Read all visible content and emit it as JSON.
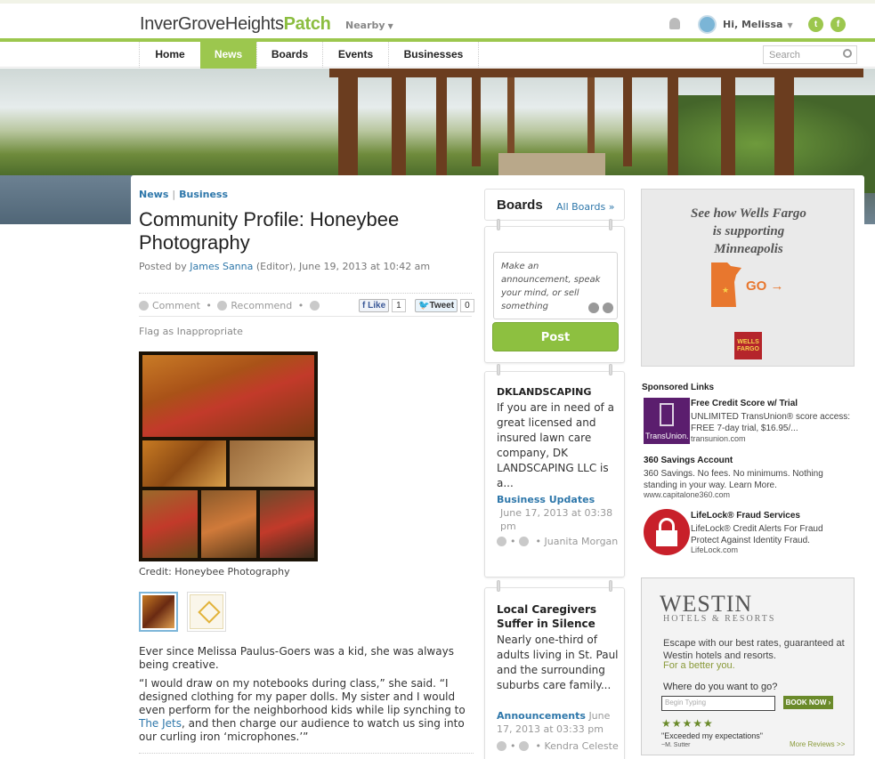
{
  "header": {
    "logo_town": "InverGroveHeights",
    "logo_brand": "Patch",
    "nearby_label": "Nearby",
    "greeting": "Hi, Melissa",
    "twitter_glyph": "t",
    "facebook_glyph": "f",
    "icons": [
      "bell-icon",
      "avatar-icon",
      "twitter-icon",
      "facebook-icon"
    ]
  },
  "nav": {
    "items": [
      "Home",
      "News",
      "Boards",
      "Events",
      "Businesses"
    ],
    "active": "News",
    "search_placeholder": "Search"
  },
  "article": {
    "breadcrumb": [
      "News",
      "Business"
    ],
    "title": "Community Profile: Honeybee Photography",
    "byline_prefix": "Posted by",
    "author": "James Sanna",
    "byline_suffix": "(Editor), June 19, 2013 at 10:42 am",
    "actions": {
      "comment": "Comment",
      "recommend": "Recommend",
      "like_label": "Like",
      "like_count": "1",
      "tweet_label": "Tweet",
      "tweet_count": "0"
    },
    "flag": "Flag as Inappropriate",
    "photo_credit": "Credit: Honeybee Photography",
    "para1": "Ever since Melissa Paulus-Goers was a kid, she was always being creative.",
    "para2_before": "“I would draw on my notebooks during class,” she said. “I designed clothing for my paper dolls. My sister and I would even perform for the neighborhood kids while lip synching to ",
    "para2_link": "The Jets",
    "para2_after": ", and then charge our audience to watch us sing into our curling iron ‘microphones.’”"
  },
  "boards": {
    "heading": "Boards",
    "all_link": "All Boards »",
    "compose_placeholder": "Make an announcement, speak your mind, or sell something",
    "post_button": "Post",
    "posts": [
      {
        "title": "DKLANDSCAPING",
        "text": "If you are in need of a great licensed and insured lawn care company, DK LANDSCAPING LLC is a...",
        "category": "Business Updates",
        "date": "June 17, 2013 at 03:38 pm",
        "author": "• Juanita Morgan"
      },
      {
        "title": "Local Caregivers Suffer in Silence",
        "text": "Nearly one-third of adults living in St. Paul and the surrounding suburbs care family...",
        "category": "Announcements",
        "date": "June 17, 2013 at 03:33 pm",
        "author": "• Kendra Celeste"
      }
    ]
  },
  "sidebar": {
    "wellsfargo_ad": {
      "line1": "See how Wells Fargo",
      "line2": "is supporting",
      "line3": "Minneapolis",
      "cta": "GO",
      "logo_text": "WELLS FARGO",
      "state_color": "#e8772e",
      "logo_color": "#b5252b"
    },
    "sponsored_heading": "Sponsored Links",
    "sponsored": [
      {
        "title": "Free Credit Score w/ Trial",
        "text": "UNLIMITED TransUnion® score access: FREE 7-day trial, $16.95/...",
        "url": "transunion.com",
        "logo_text": "TransUnion."
      },
      {
        "title": "360 Savings Account",
        "text": "360 Savings. No fees. No minimums. Nothing standing in your way. Learn More.",
        "url": "www.capitalone360.com"
      },
      {
        "title": "LifeLock® Fraud Services",
        "text": "LifeLock® Credit Alerts For Fraud Protect Against Identity Fraud.",
        "url": "LifeLock.com"
      }
    ],
    "westin_ad": {
      "logo": "WESTIN",
      "sub": "HOTELS & RESORTS",
      "text": "Escape with our best rates, guaranteed at Westin hotels and resorts.",
      "tagline": "For a better you.",
      "question": "Where do you want to go?",
      "input_placeholder": "Begin Typing",
      "button": "BOOK NOW ›",
      "stars": "★★★★★",
      "quote": "\"Exceeded my expectations\"",
      "author": "~M. Sutter",
      "more": "More Reviews >>"
    }
  },
  "colors": {
    "brand_green": "#9cc74e",
    "link_blue": "#2e77aa"
  }
}
